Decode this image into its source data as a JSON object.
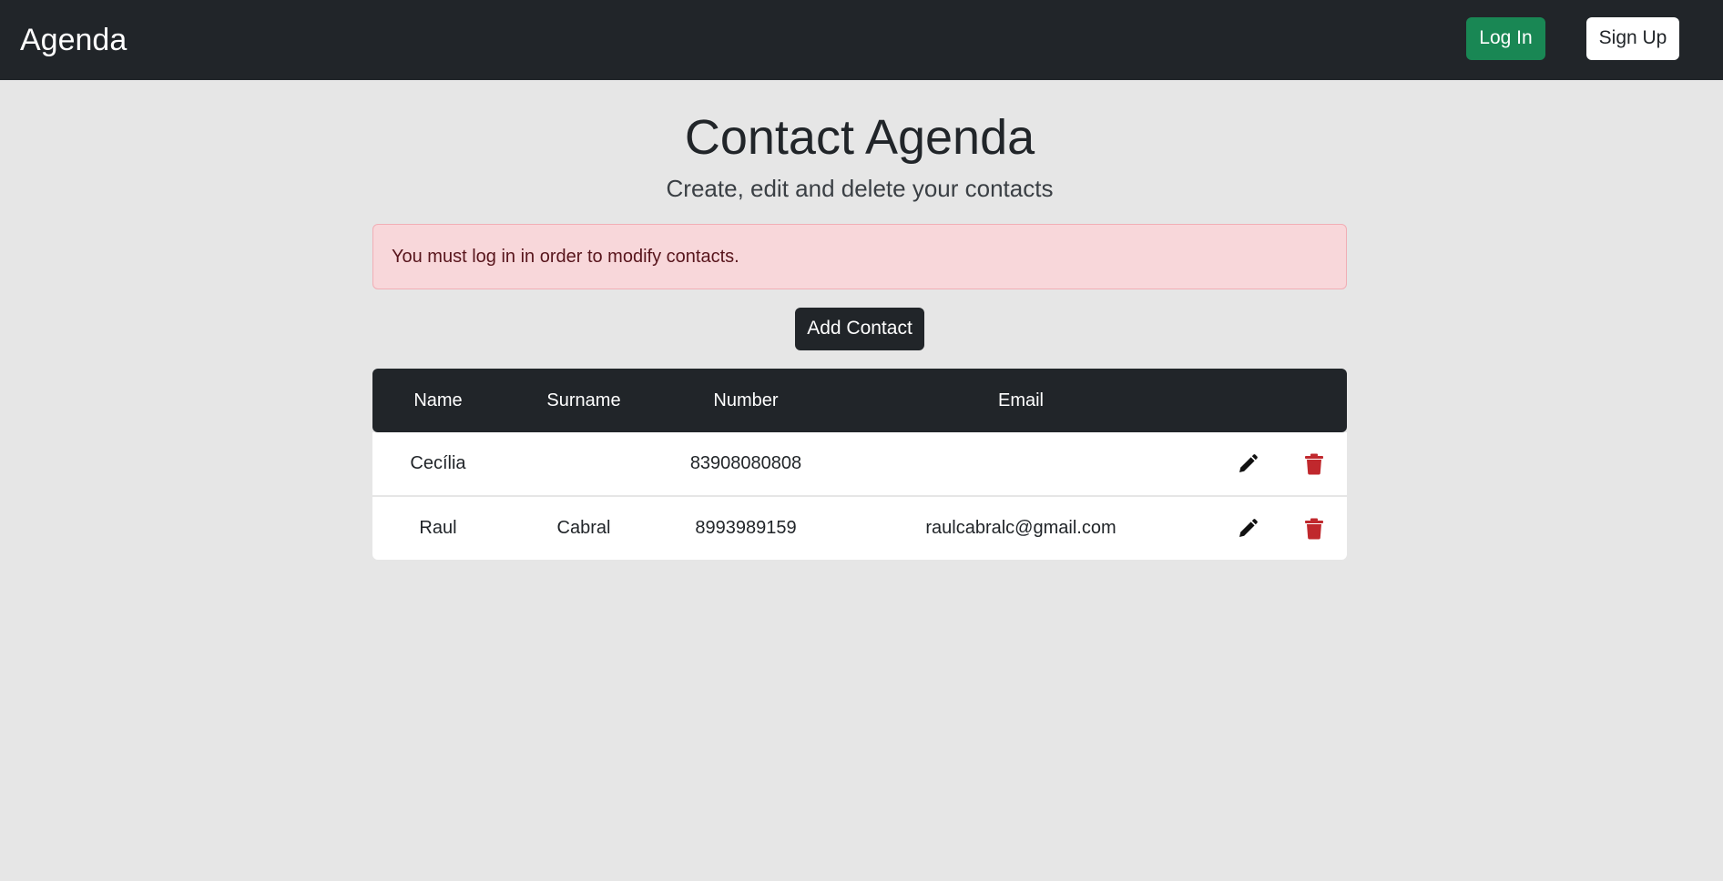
{
  "navbar": {
    "brand": "Agenda",
    "login_label": "Log In",
    "signup_label": "Sign Up"
  },
  "header": {
    "title": "Contact Agenda",
    "subtitle": "Create, edit and delete your contacts"
  },
  "alert": {
    "message": "You must log in in order to modify contacts."
  },
  "actions": {
    "add_label": "Add Contact"
  },
  "table": {
    "columns": [
      "Name",
      "Surname",
      "Number",
      "Email"
    ],
    "rows": [
      {
        "name": "Cecília",
        "surname": "",
        "number": "83908080808",
        "email": ""
      },
      {
        "name": "Raul",
        "surname": "Cabral",
        "number": "8993989159",
        "email": "raulcabralc@gmail.com"
      }
    ]
  },
  "icons": {
    "edit": "pencil-icon",
    "delete": "trash-icon"
  },
  "colors": {
    "navbar_bg": "#212529",
    "login_green": "#198754",
    "alert_bg": "#f8d7da",
    "delete_red": "#c0282d"
  }
}
